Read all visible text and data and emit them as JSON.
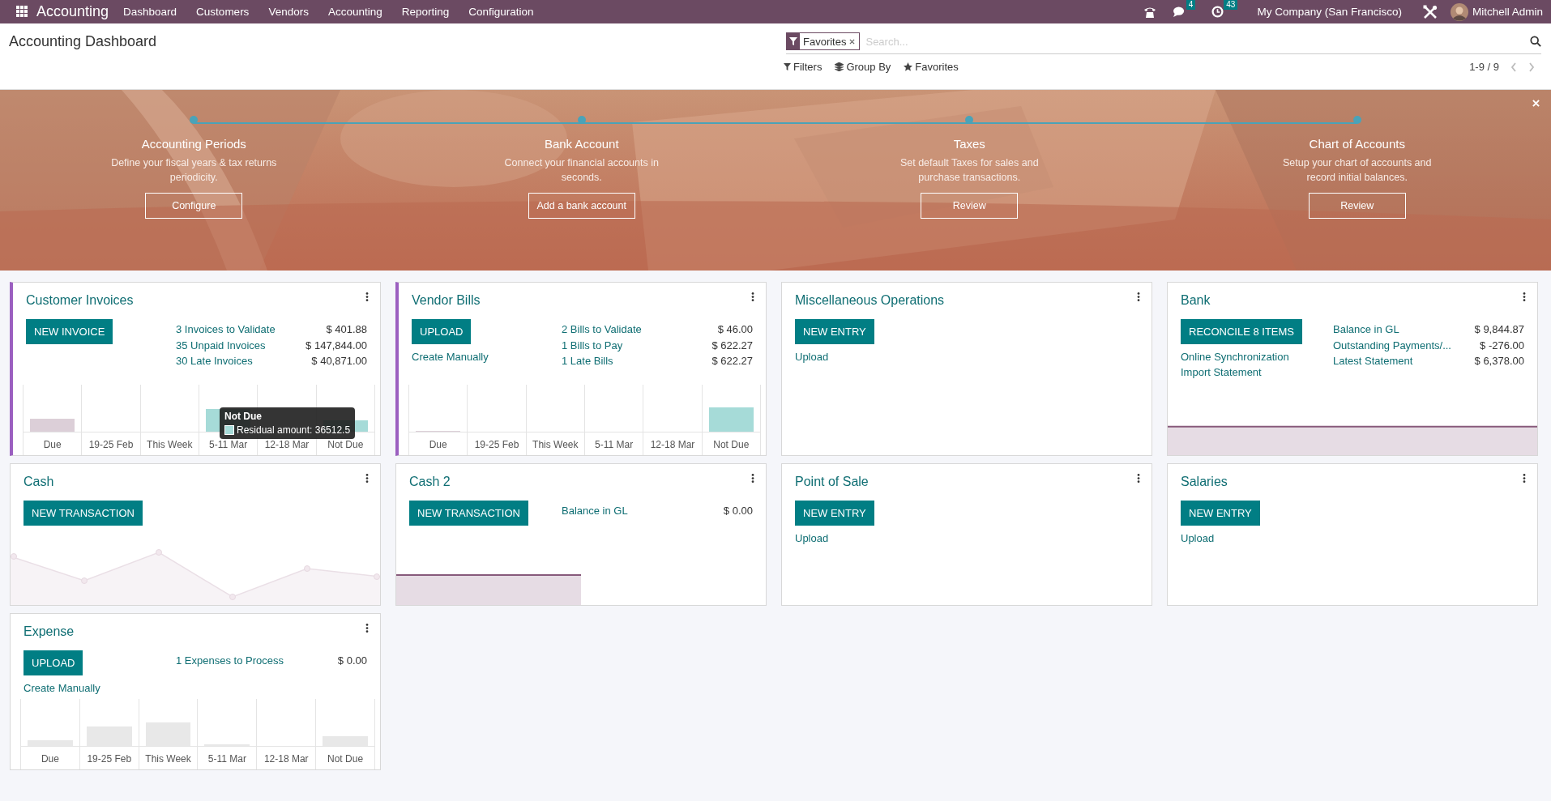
{
  "navbar": {
    "app": "Accounting",
    "menu": [
      "Dashboard",
      "Customers",
      "Vendors",
      "Accounting",
      "Reporting",
      "Configuration"
    ],
    "messages_count": "4",
    "activities_count": "43",
    "company": "My Company (San Francisco)",
    "user": "Mitchell Admin"
  },
  "control_panel": {
    "title": "Accounting Dashboard",
    "facet": "Favorites",
    "search": {
      "placeholder": "Search..."
    },
    "search_options": [
      "Filters",
      "Group By",
      "Favorites"
    ],
    "pager": "1-9 / 9"
  },
  "onboarding": {
    "steps": [
      {
        "title": "Accounting Periods",
        "description": "Define your fiscal years & tax returns periodicity.",
        "button": "Configure"
      },
      {
        "title": "Bank Account",
        "description": "Connect your financial accounts in seconds.",
        "button": "Add a bank account"
      },
      {
        "title": "Taxes",
        "description": "Set default Taxes for sales and purchase transactions.",
        "button": "Review"
      },
      {
        "title": "Chart of Accounts",
        "description": "Setup your chart of accounts and record initial balances.",
        "button": "Review"
      }
    ]
  },
  "journals": [
    {
      "title": "Customer Invoices",
      "color": "#9b5fc0",
      "button": "NEW INVOICE",
      "stats": [
        {
          "label": "3 Invoices to Validate",
          "value": "$ 401.88"
        },
        {
          "label": "35 Unpaid Invoices",
          "value": "$ 147,844.00"
        },
        {
          "label": "30 Late Invoices",
          "value": "$ 40,871.00"
        }
      ],
      "graph": {
        "kind": "bar",
        "labels": [
          "Due",
          "19-25 Feb",
          "This Week",
          "5-11 Mar",
          "12-18 Mar",
          "Not Due"
        ]
      },
      "tooltip": {
        "title": "Not Due",
        "label": "Residual amount: 36512.5"
      }
    },
    {
      "title": "Vendor Bills",
      "color": "#9b5fc0",
      "button": "UPLOAD",
      "links": [
        "Create Manually"
      ],
      "stats": [
        {
          "label": "2 Bills to Validate",
          "value": "$ 46.00"
        },
        {
          "label": "1 Bills to Pay",
          "value": "$ 622.27"
        },
        {
          "label": "1 Late Bills",
          "value": "$ 622.27"
        }
      ],
      "graph": {
        "kind": "bar",
        "labels": [
          "Due",
          "19-25 Feb",
          "This Week",
          "5-11 Mar",
          "12-18 Mar",
          "Not Due"
        ]
      }
    },
    {
      "title": "Miscellaneous Operations",
      "button": "NEW ENTRY",
      "links": [
        "Upload"
      ]
    },
    {
      "title": "Bank",
      "button": "RECONCILE 8 ITEMS",
      "links": [
        "Online Synchronization",
        "Import Statement"
      ],
      "stats": [
        {
          "label": "Balance in GL",
          "value": "$ 9,844.87"
        },
        {
          "label": "Outstanding Payments/...",
          "value": "$ -276.00"
        },
        {
          "label": "Latest Statement",
          "value": "$ 6,378.00"
        }
      ],
      "graph": {
        "kind": "area"
      }
    },
    {
      "title": "Cash",
      "button": "NEW TRANSACTION",
      "graph": {
        "kind": "line"
      }
    },
    {
      "title": "Cash 2",
      "button": "NEW TRANSACTION",
      "stats": [
        {
          "label": "Balance in GL",
          "value": "$ 0.00"
        }
      ],
      "graph": {
        "kind": "area"
      }
    },
    {
      "title": "Point of Sale",
      "button": "NEW ENTRY",
      "links": [
        "Upload"
      ]
    },
    {
      "title": "Salaries",
      "button": "NEW ENTRY",
      "links": [
        "Upload"
      ]
    },
    {
      "title": "Expense",
      "button": "UPLOAD",
      "links": [
        "Create Manually"
      ],
      "stats": [
        {
          "label": "1 Expenses to Process",
          "value": "$ 0.00"
        }
      ],
      "graph": {
        "kind": "bar",
        "labels": [
          "Due",
          "19-25 Feb",
          "This Week",
          "5-11 Mar",
          "12-18 Mar",
          "Not Due"
        ]
      }
    }
  ]
}
